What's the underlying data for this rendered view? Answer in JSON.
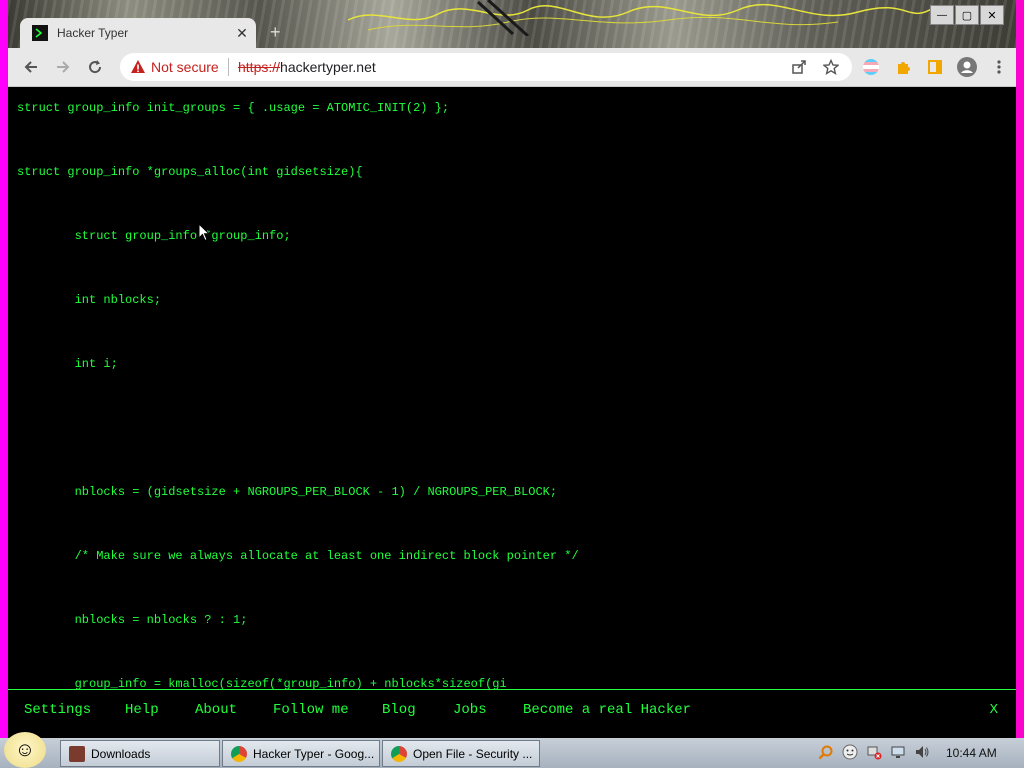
{
  "tab": {
    "title": "Hacker Typer",
    "close_label": "✕",
    "new_tab_label": "+"
  },
  "window": {
    "minimize_label": "—",
    "maximize_label": "▢",
    "close_label": "✕"
  },
  "toolbar": {
    "security_text": "Not secure",
    "url_scheme": "https://",
    "url_host": "hackertyper.net",
    "icons": [
      "back-icon",
      "forward-icon",
      "reload-icon",
      "share-icon",
      "star-icon",
      "profile-flag-icon",
      "extensions-icon",
      "sidebar-icon",
      "account-icon",
      "menu-icon"
    ]
  },
  "code_lines": [
    "struct group_info init_groups = { .usage = ATOMIC_INIT(2) };",
    "",
    "struct group_info *groups_alloc(int gidsetsize){",
    "",
    "        struct group_info *group_info;",
    "",
    "        int nblocks;",
    "",
    "        int i;",
    "",
    "",
    "",
    "        nblocks = (gidsetsize + NGROUPS_PER_BLOCK - 1) / NGROUPS_PER_BLOCK;",
    "",
    "        /* Make sure we always allocate at least one indirect block pointer */",
    "",
    "        nblocks = nblocks ? : 1;",
    "",
    "        group_info = kmalloc(sizeof(*group_info) + nblocks*sizeof(gi"
  ],
  "menu": {
    "items": [
      "Settings",
      "Help",
      "About",
      "Follow me",
      "Blog",
      "Jobs",
      "Become a real Hacker"
    ],
    "close_label": "X"
  },
  "taskbar": {
    "tasks": [
      "Downloads",
      "Hacker Typer - Goog...",
      "Open File - Security ..."
    ],
    "clock": "10:44 AM"
  },
  "colors": {
    "terminal_green": "#21ff3d",
    "warning_red": "#c5221f"
  }
}
